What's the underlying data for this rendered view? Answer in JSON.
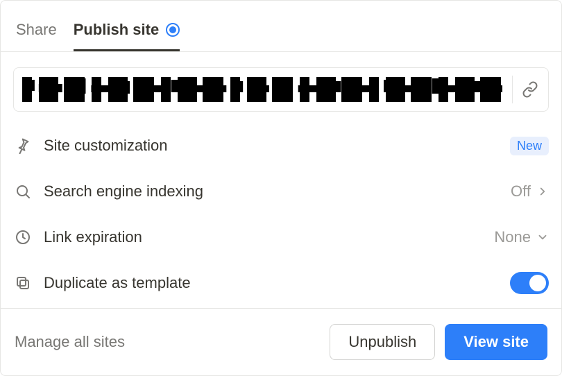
{
  "tabs": {
    "share": "Share",
    "publish": "Publish site"
  },
  "url": {
    "redacted": true
  },
  "options": {
    "customization": {
      "label": "Site customization",
      "badge": "New"
    },
    "search_indexing": {
      "label": "Search engine indexing",
      "value": "Off"
    },
    "link_expiration": {
      "label": "Link expiration",
      "value": "None"
    },
    "duplicate_template": {
      "label": "Duplicate as template",
      "on": true
    }
  },
  "footer": {
    "manage": "Manage all sites",
    "unpublish": "Unpublish",
    "view": "View site"
  }
}
